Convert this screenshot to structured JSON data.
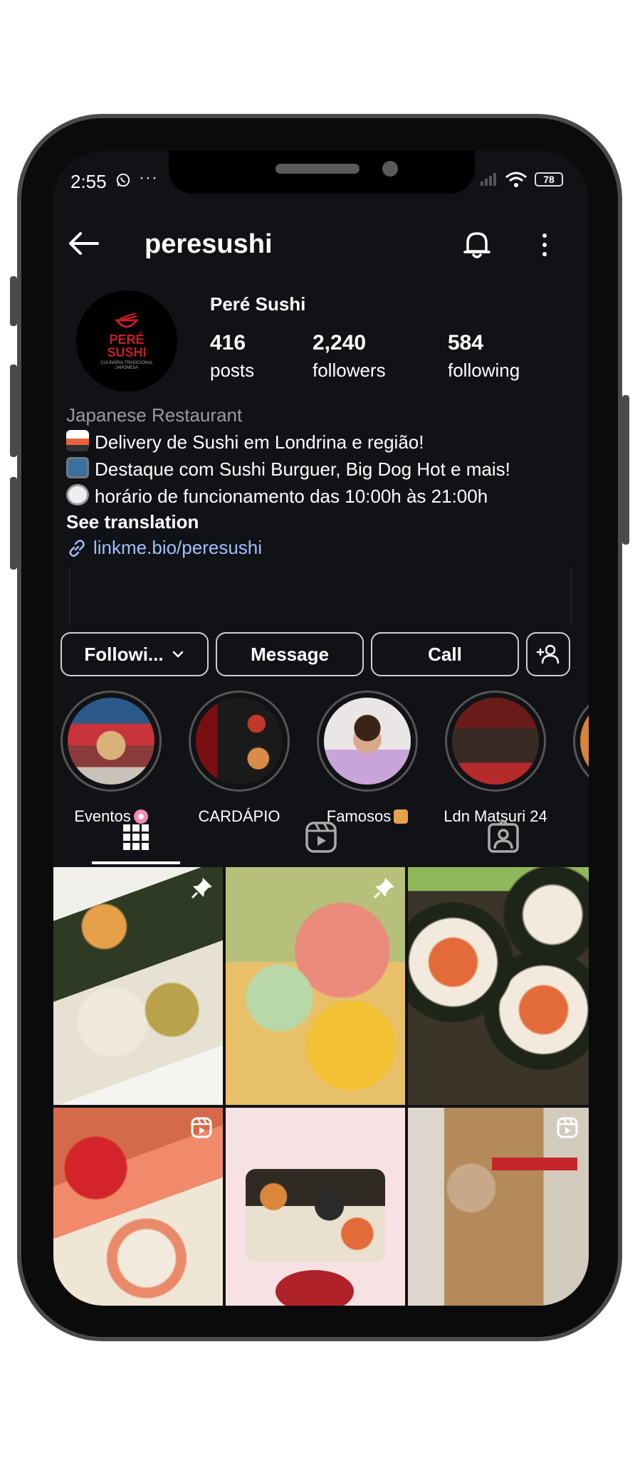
{
  "status_bar": {
    "time": "2:55",
    "battery": "78"
  },
  "header": {
    "handle": "peresushi"
  },
  "profile": {
    "display_name": "Peré Sushi",
    "logo_text_1": "PERÉ",
    "logo_text_2": "SUSHI",
    "logo_tagline": "CULINÁRIA TRADICIONAL JAPONESA",
    "stats": [
      {
        "value": "416",
        "label": "posts"
      },
      {
        "value": "2,240",
        "label": "followers"
      },
      {
        "value": "584",
        "label": "following"
      }
    ],
    "category": "Japanese Restaurant",
    "bio": [
      {
        "emoji_icon": "sushi-emoji-icon",
        "text": "Delivery de Sushi em Londrina e região!"
      },
      {
        "emoji_icon": "tv-emoji-icon",
        "text": "Destaque com Sushi Burguer, Big Dog Hot e mais!"
      },
      {
        "emoji_icon": "stopwatch-emoji-icon",
        "text": "horário de funcionamento das 10:00h às 21:00h"
      }
    ],
    "see_translation": "See translation",
    "link": "linkme.bio/peresushi"
  },
  "actions": {
    "following": "Followi...",
    "message": "Message",
    "call": "Call"
  },
  "highlights": [
    {
      "label": "Eventos",
      "emoji_icon": "pink-flower-icon"
    },
    {
      "label": "CARDÁPIO"
    },
    {
      "label": "Famosos",
      "emoji_icon": "heart-hands-icon"
    },
    {
      "label": "Ldn Matsuri 24"
    }
  ],
  "colors": {
    "background": "#111215",
    "link": "#9ec0ff",
    "category": "#9a9a9a",
    "brand_red": "#c21f24"
  }
}
